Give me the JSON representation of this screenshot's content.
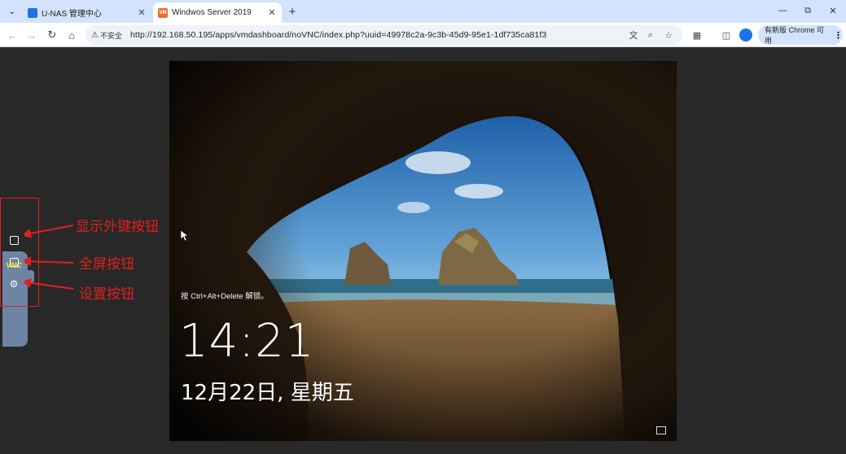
{
  "browser": {
    "tabs": [
      {
        "title": "U-NAS 管理中心",
        "active": false
      },
      {
        "title": "Windwos Server 2019",
        "active": true
      }
    ],
    "favicon_vm_text": "VM",
    "new_tab_label": "+",
    "omnibox": {
      "security_label": "不安全",
      "url": "http://192.168.50.195/apps/vmdashboard/noVNC/index.php?uuid=49978c2a-9c3b-45d9-95e1-1df735ca81f3"
    },
    "update_button_label": "有新版 Chrome 可用"
  },
  "novnc": {
    "logo_text": "VNC",
    "lockscreen": {
      "unlock_hint": "按 Ctrl+Alt+Delete 解锁。",
      "time": "14:21",
      "date": "12月22日, 星期五"
    }
  },
  "annotations": {
    "keys_button": "显示外键按钮",
    "fullscreen_button": "全屏按钮",
    "settings_button": "设置按钮"
  },
  "colors": {
    "annotation": "#e02020",
    "tabstrip": "#d3e3fd",
    "control_bar": "#6e84a3",
    "viewport_bg": "#282828"
  }
}
